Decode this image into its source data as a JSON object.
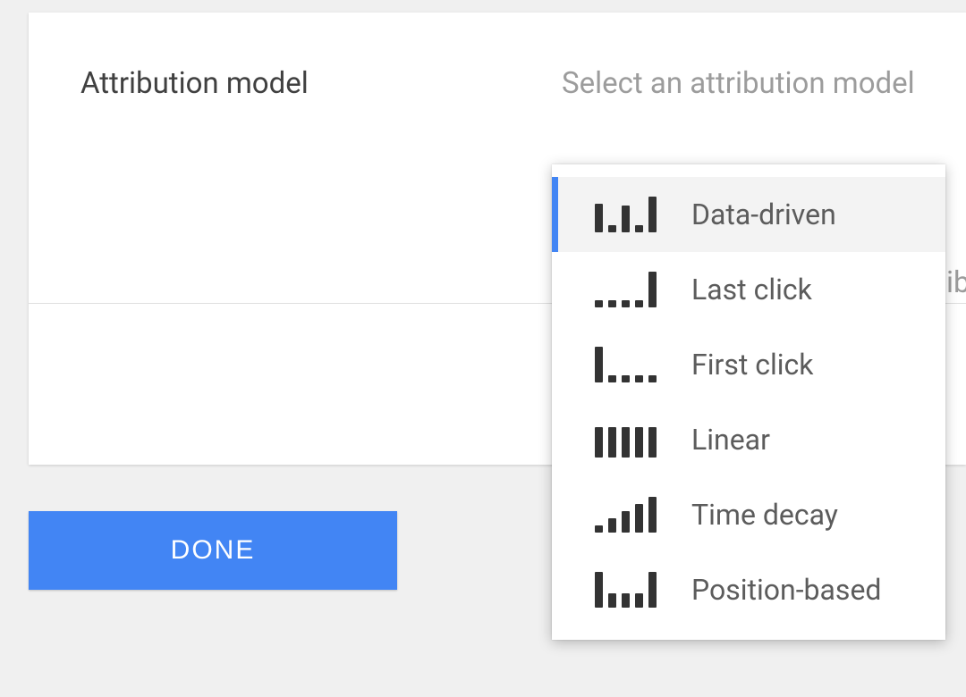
{
  "field": {
    "label": "Attribution model",
    "placeholder": "Select an attribution model"
  },
  "done_label": "DONE",
  "options": [
    {
      "key": "data-driven",
      "label": "Data-driven",
      "icon": "data-driven-icon",
      "bars": [
        32,
        8,
        30,
        8,
        40
      ],
      "highlighted": true
    },
    {
      "key": "last-click",
      "label": "Last click",
      "icon": "last-click-icon",
      "bars": [
        8,
        8,
        8,
        8,
        40
      ],
      "highlighted": false
    },
    {
      "key": "first-click",
      "label": "First click",
      "icon": "first-click-icon",
      "bars": [
        40,
        8,
        8,
        8,
        8
      ],
      "highlighted": false
    },
    {
      "key": "linear",
      "label": "Linear",
      "icon": "linear-icon",
      "bars": [
        34,
        34,
        34,
        34,
        34
      ],
      "highlighted": false
    },
    {
      "key": "time-decay",
      "label": "Time decay",
      "icon": "time-decay-icon",
      "bars": [
        8,
        16,
        24,
        32,
        40
      ],
      "highlighted": false
    },
    {
      "key": "position-based",
      "label": "Position-based",
      "icon": "position-based-icon",
      "bars": [
        40,
        16,
        16,
        16,
        40
      ],
      "highlighted": false
    }
  ],
  "peek": "ib"
}
